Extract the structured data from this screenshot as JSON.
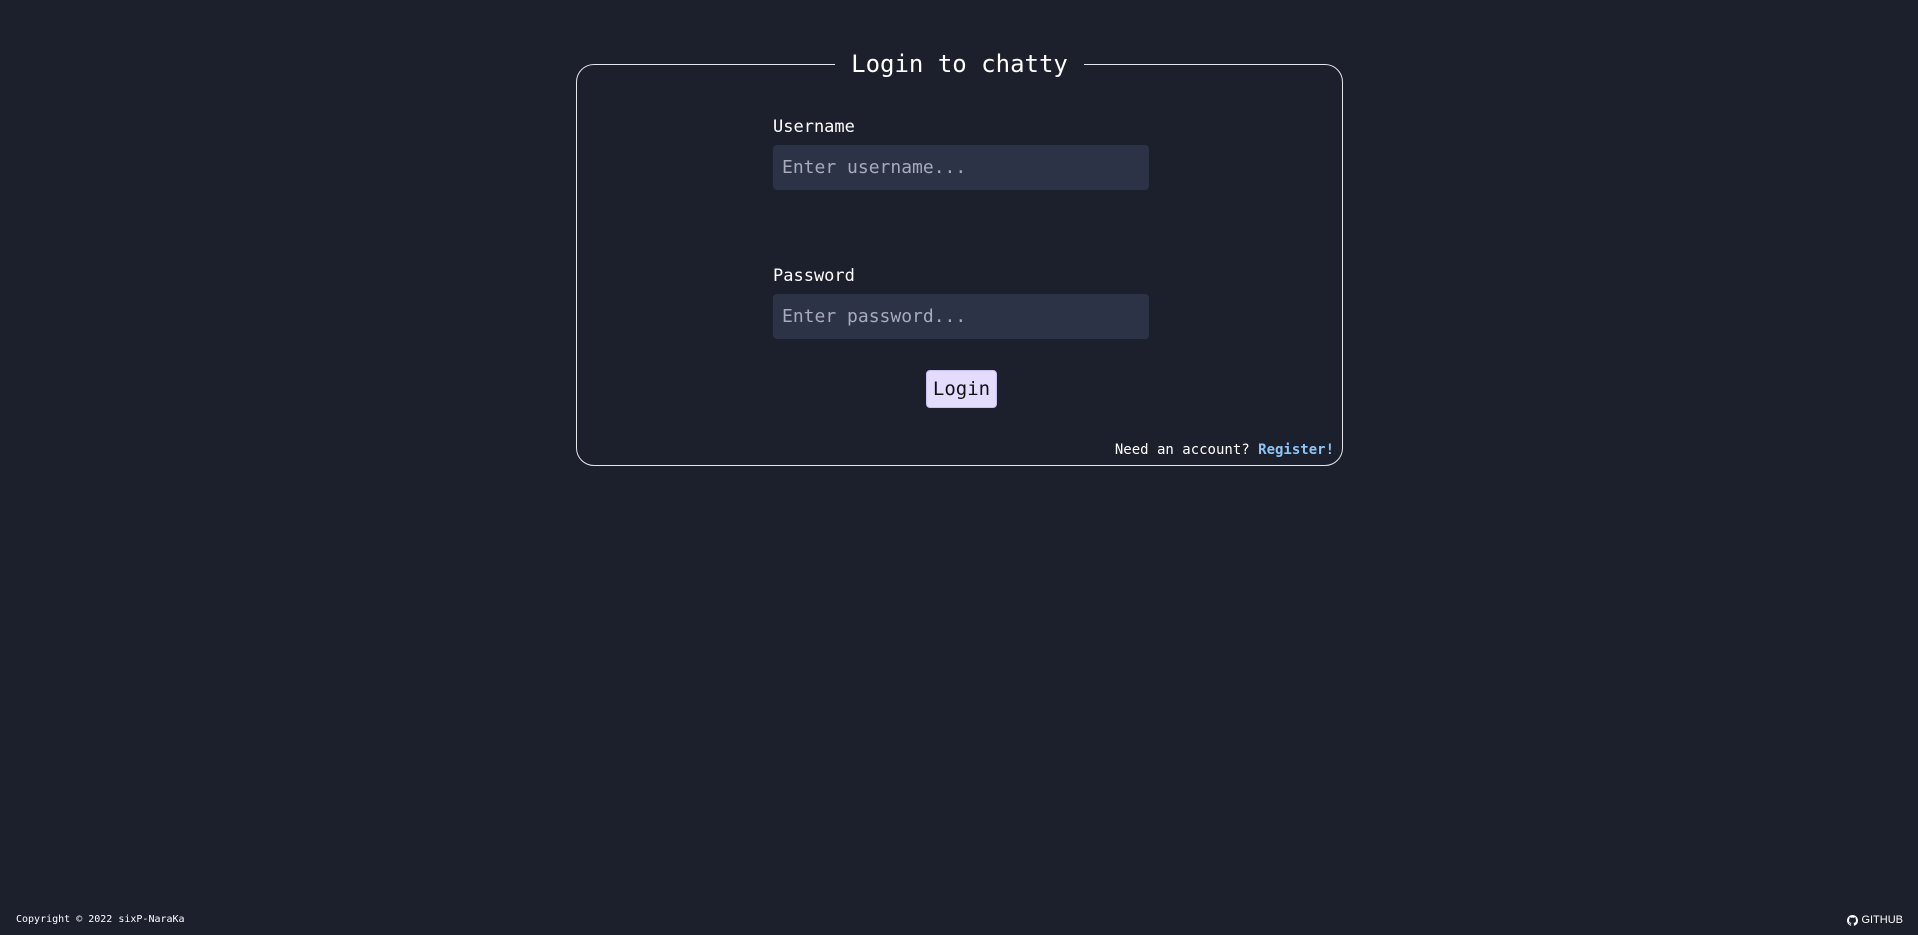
{
  "login": {
    "title": "Login to chatty",
    "username": {
      "label": "Username",
      "placeholder": "Enter username...",
      "value": ""
    },
    "password": {
      "label": "Password",
      "placeholder": "Enter password...",
      "value": ""
    },
    "submit_label": "Login",
    "register_prompt": "Need an account?",
    "register_link": "Register!"
  },
  "footer": {
    "copyright": "Copyright © 2022 sixP-NaraKa",
    "github_label": "GITHUB",
    "github_icon": "github-icon"
  },
  "colors": {
    "background": "#1c1f2c",
    "input_background": "#2c3346",
    "button_background": "#e4dcfc",
    "link": "#8ec5f5",
    "border": "#e6e6ee"
  }
}
